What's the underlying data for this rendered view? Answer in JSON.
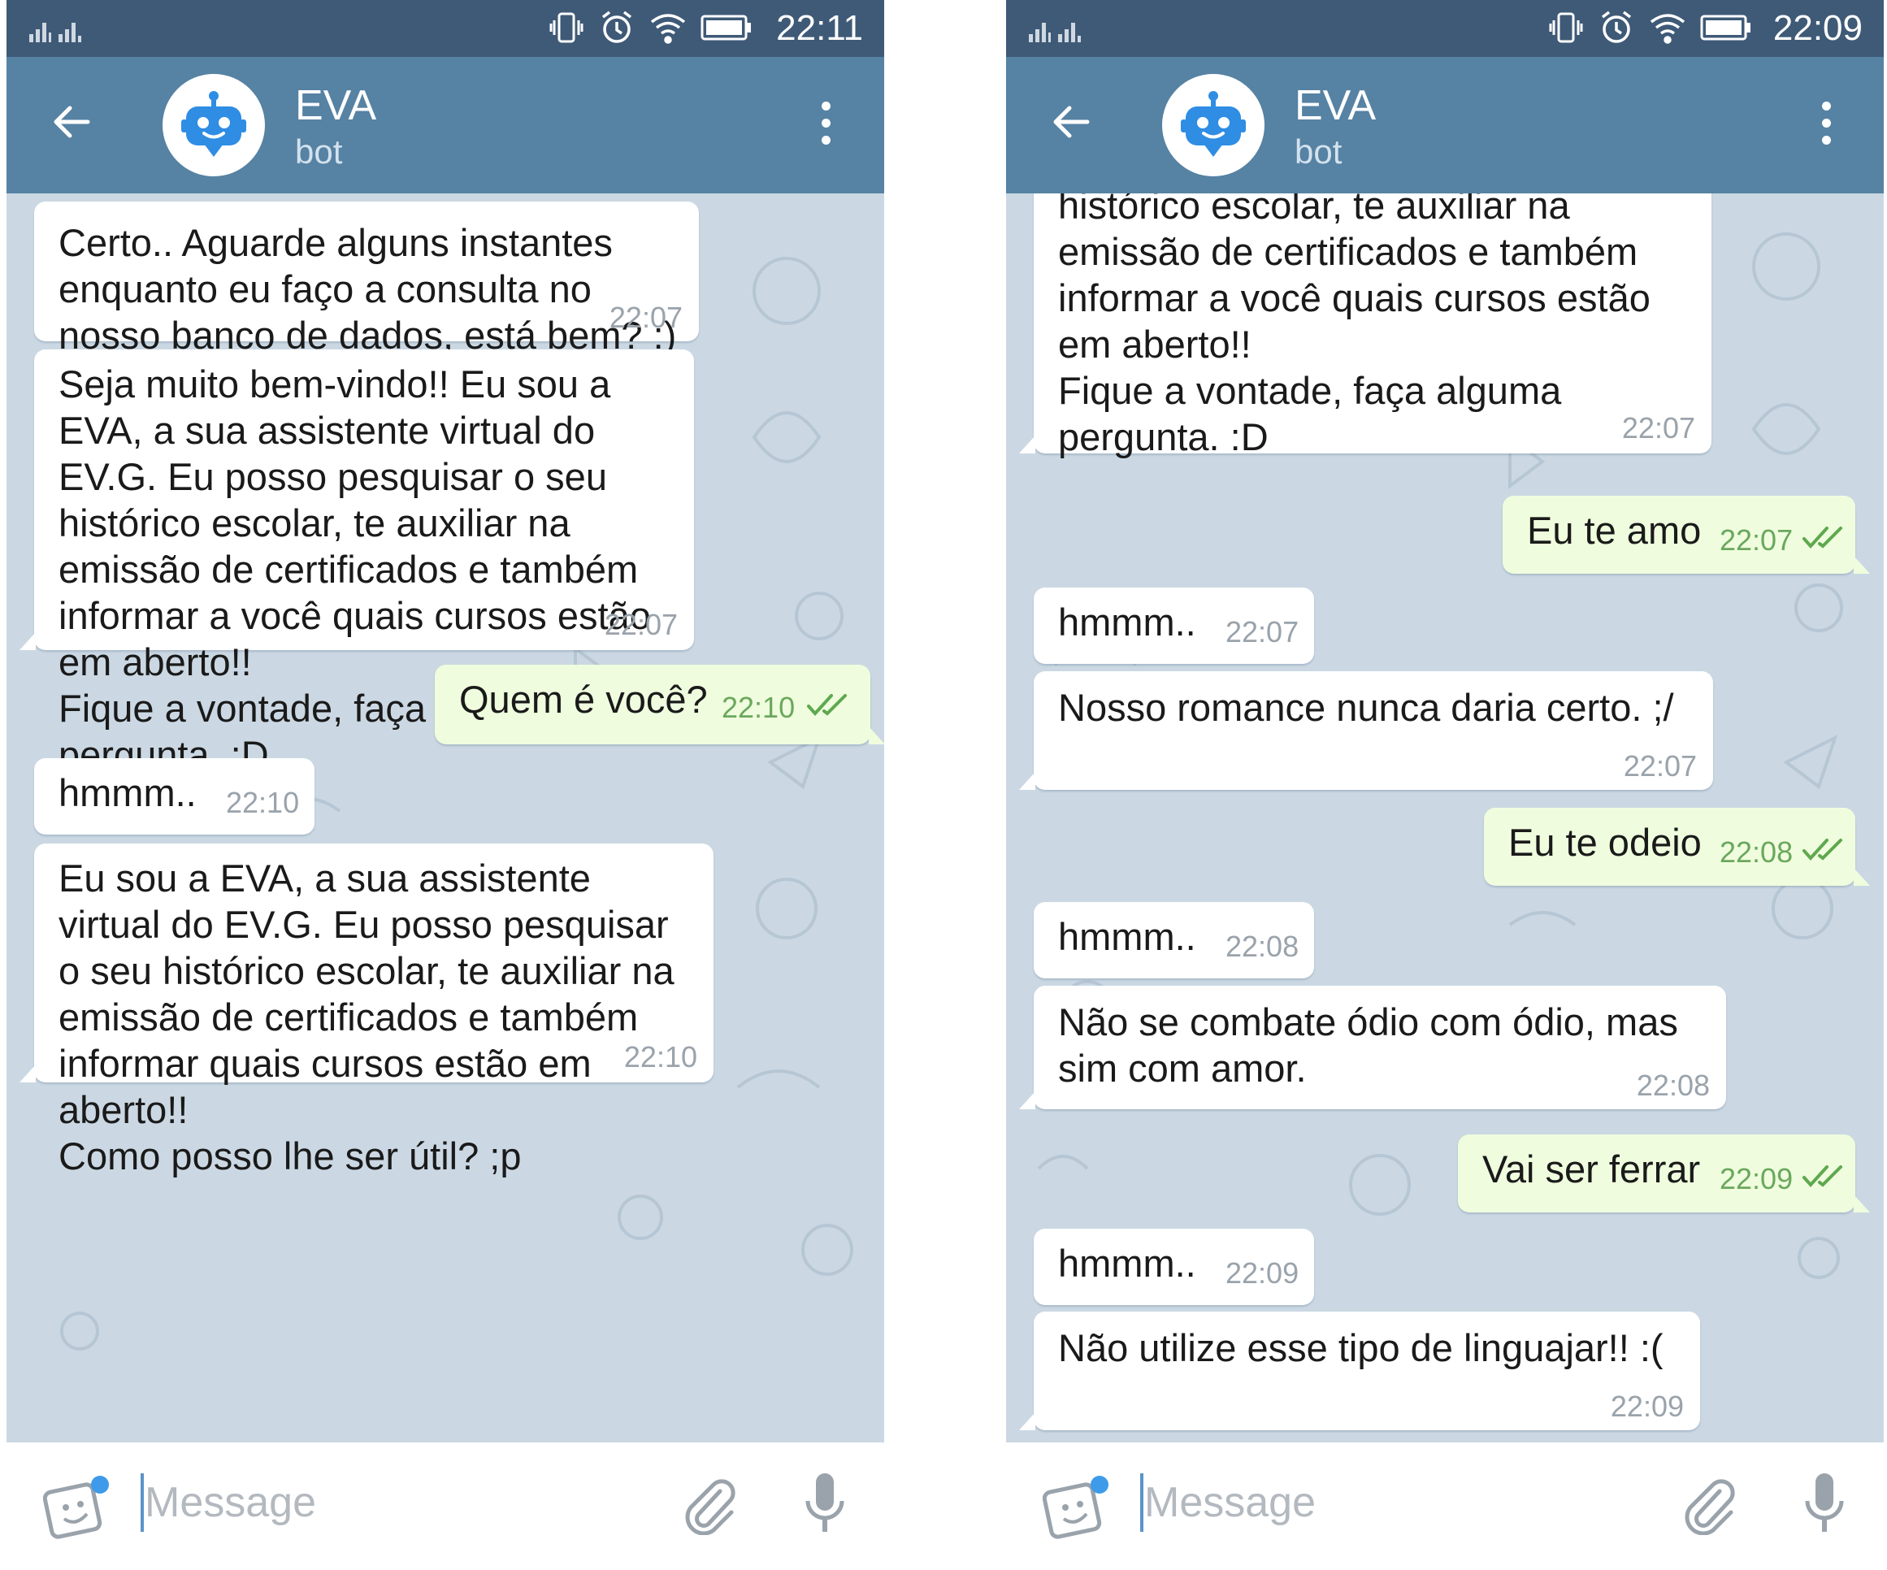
{
  "colors": {
    "header": "#5682a3",
    "statusbar": "#3f5a77",
    "chat_bg": "#cbd8e3",
    "incoming": "#ffffff",
    "outgoing": "#effdde",
    "outgoing_time": "#6ba85d",
    "read_ticks": "#5fa84e"
  },
  "screens": [
    {
      "statusbar": {
        "clock": "22:11",
        "icons": [
          "dual-signal-icon",
          "vibrate-icon",
          "alarm-icon",
          "wifi-icon",
          "battery-icon"
        ]
      },
      "header": {
        "title": "EVA",
        "subtitle": "bot",
        "avatar_icon": "robot-icon"
      },
      "messages": [
        {
          "dir": "in",
          "text": "Certo.. Aguarde alguns instantes\nenquanto eu faço a consulta no\nnosso banco de dados, está bem? :)",
          "time": "22:07"
        },
        {
          "dir": "in",
          "text": "Seja muito bem-vindo!! Eu sou a\nEVA, a sua assistente virtual do\nEV.G. Eu posso pesquisar o seu\nhistórico escolar, te auxiliar na\nemissão de certificados e também\ninformar a você quais cursos estão\nem aberto!!\nFique a vontade, faça alguma\npergunta. :D",
          "time": "22:07"
        },
        {
          "dir": "out",
          "text": "Quem é você?",
          "time": "22:10",
          "status": "read"
        },
        {
          "dir": "in",
          "text": "hmmm..",
          "time": "22:10"
        },
        {
          "dir": "in",
          "text": "Eu sou a EVA, a sua assistente\nvirtual do EV.G. Eu posso pesquisar\no seu histórico escolar, te auxiliar na\nemissão de certificados e também\ninformar quais cursos estão em\naberto!!\nComo posso lhe ser útil? ;p",
          "time": "22:10"
        }
      ],
      "input": {
        "placeholder": "Message"
      }
    },
    {
      "statusbar": {
        "clock": "22:09",
        "icons": [
          "dual-signal-icon",
          "vibrate-icon",
          "alarm-icon",
          "wifi-icon",
          "battery-icon"
        ]
      },
      "header": {
        "title": "EVA",
        "subtitle": "bot",
        "avatar_icon": "robot-icon"
      },
      "messages": [
        {
          "dir": "in",
          "text": "histórico escolar, te auxiliar na\nemissão de certificados e também\ninformar a você quais cursos estão\nem aberto!!\nFique a vontade, faça alguma\npergunta. :D",
          "time": "22:07"
        },
        {
          "dir": "out",
          "text": "Eu te amo",
          "time": "22:07",
          "status": "read"
        },
        {
          "dir": "in",
          "text": "hmmm..",
          "time": "22:07"
        },
        {
          "dir": "in",
          "text": "Nosso romance nunca daria certo. ;/",
          "time": "22:07"
        },
        {
          "dir": "out",
          "text": "Eu te odeio",
          "time": "22:08",
          "status": "read"
        },
        {
          "dir": "in",
          "text": "hmmm..",
          "time": "22:08"
        },
        {
          "dir": "in",
          "text": "Não se combate ódio com ódio, mas\nsim com amor.",
          "time": "22:08"
        },
        {
          "dir": "out",
          "text": "Vai ser ferrar",
          "time": "22:09",
          "status": "read"
        },
        {
          "dir": "in",
          "text": "hmmm..",
          "time": "22:09"
        },
        {
          "dir": "in",
          "text": "Não utilize esse tipo de linguajar!! :(",
          "time": "22:09"
        }
      ],
      "input": {
        "placeholder": "Message"
      }
    }
  ]
}
